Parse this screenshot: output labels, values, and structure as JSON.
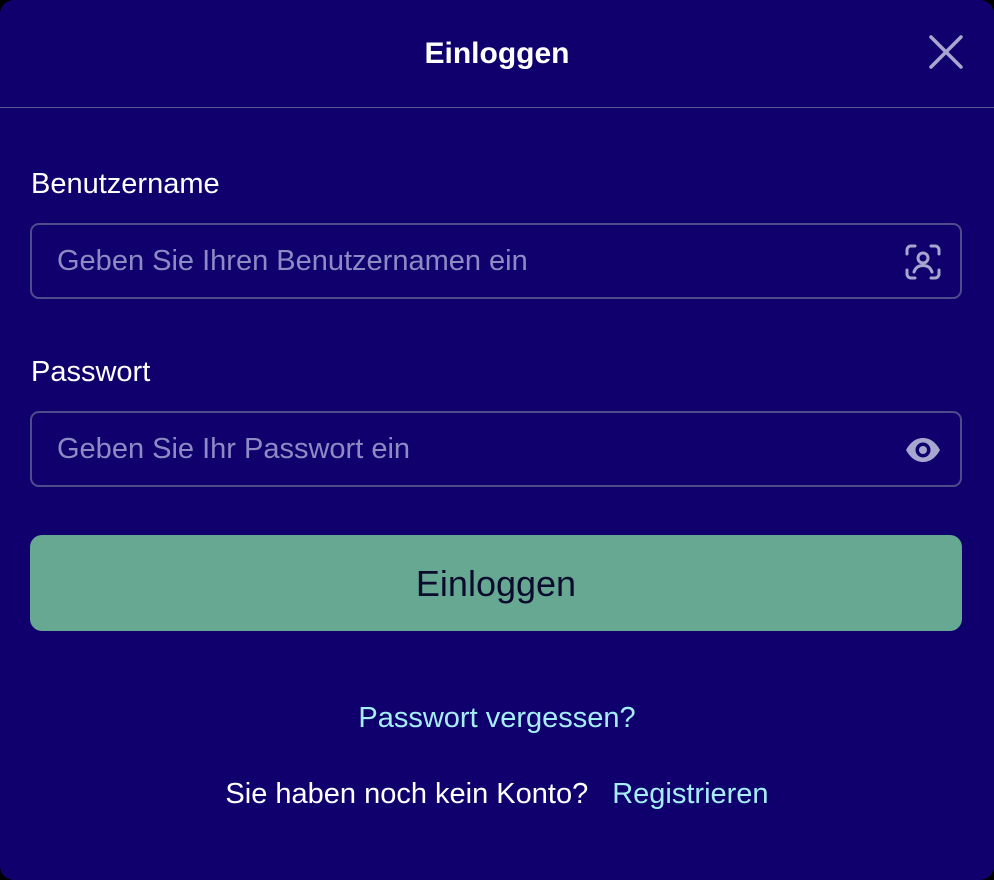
{
  "modal": {
    "title": "Einloggen",
    "close_icon": "close-icon"
  },
  "username": {
    "label": "Benutzername",
    "placeholder": "Geben Sie Ihren Benutzernamen ein",
    "value": "",
    "icon": "user-scan-icon"
  },
  "password": {
    "label": "Passwort",
    "placeholder": "Geben Sie Ihr Passwort ein",
    "value": "",
    "icon": "eye-icon"
  },
  "login_button": {
    "label": "Einloggen"
  },
  "forgot_password": {
    "label": "Passwort vergessen?"
  },
  "register": {
    "prompt": "Sie haben noch kein Konto?",
    "link": "Registrieren"
  },
  "colors": {
    "background": "#10006e",
    "button": "#67a892",
    "link": "#a7edf7",
    "border": "#4f4c8c"
  }
}
